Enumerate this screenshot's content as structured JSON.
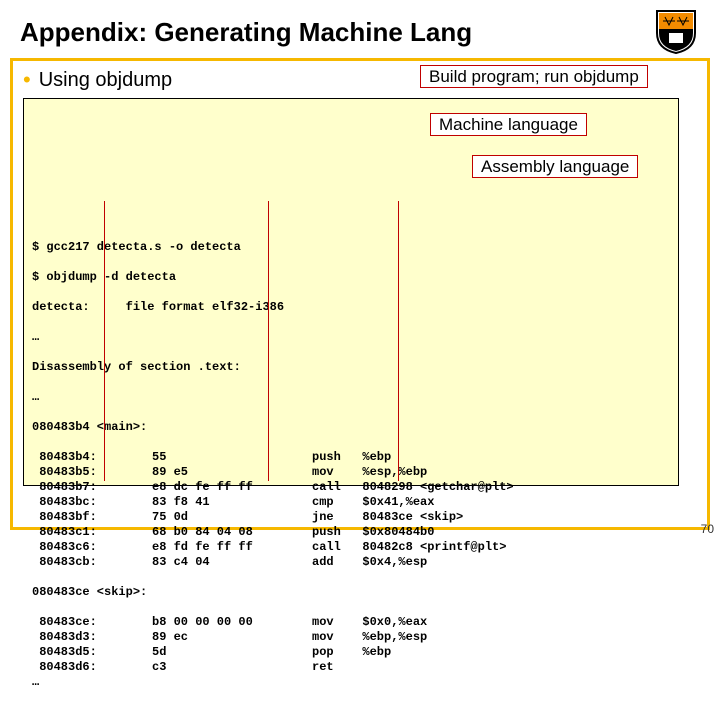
{
  "title": "Appendix: Generating Machine Lang",
  "bullet": "Using objdump",
  "annot": {
    "a1": "Build program; run objdump",
    "a2": "Machine language",
    "a3": "Assembly language"
  },
  "cmd": {
    "l1": "$ gcc217 detecta.s -o detecta",
    "l2": "$ objdump -d detecta",
    "l3": "detecta:     file format elf32-i386",
    "l4": "…",
    "l5": "Disassembly of section .text:",
    "l6": "…",
    "mainlabel": "080483b4 <main>:",
    "m0a": " 80483b4:",
    "m0b": "55",
    "m0c": "push   %ebp",
    "m1a": " 80483b5:",
    "m1b": "89 e5",
    "m1c": "mov    %esp,%ebp",
    "m2a": " 80483b7:",
    "m2b": "e8 dc fe ff ff",
    "m2c": "call   8048298 <getchar@plt>",
    "m3a": " 80483bc:",
    "m3b": "83 f8 41",
    "m3c": "cmp    $0x41,%eax",
    "m4a": " 80483bf:",
    "m4b": "75 0d",
    "m4c": "jne    80483ce <skip>",
    "m5a": " 80483c1:",
    "m5b": "68 b0 84 04 08",
    "m5c": "push   $0x80484b0",
    "m6a": " 80483c6:",
    "m6b": "e8 fd fe ff ff",
    "m6c": "call   80482c8 <printf@plt>",
    "m7a": " 80483cb:",
    "m7b": "83 c4 04",
    "m7c": "add    $0x4,%esp",
    "blank": "",
    "skiplabel": "080483ce <skip>:",
    "s0a": " 80483ce:",
    "s0b": "b8 00 00 00 00",
    "s0c": "mov    $0x0,%eax",
    "s1a": " 80483d3:",
    "s1b": "89 ec",
    "s1c": "mov    %ebp,%esp",
    "s2a": " 80483d5:",
    "s2b": "5d",
    "s2c": "pop    %ebp",
    "s3a": " 80483d6:",
    "s3b": "c3",
    "s3c": "ret",
    "end": "…"
  },
  "pagenum": "70"
}
